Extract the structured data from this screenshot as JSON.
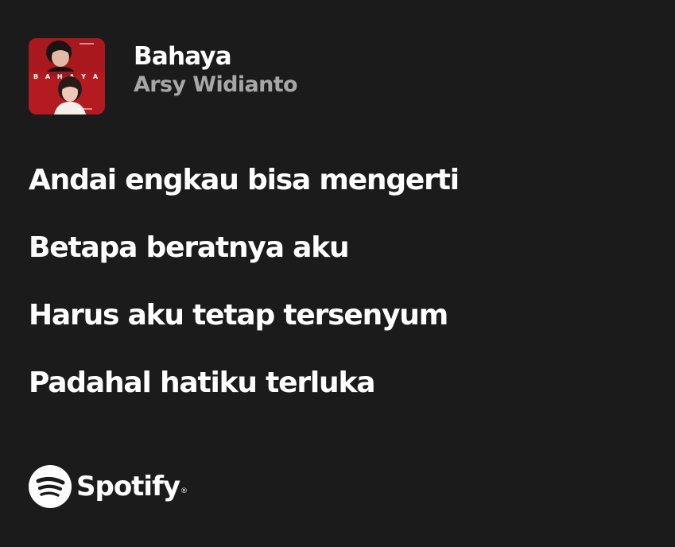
{
  "track": {
    "title": "Bahaya",
    "artist": "Arsy Widianto",
    "cover": {
      "lettering": "B A H A Y A",
      "background_color": "#b31b20"
    }
  },
  "lyrics": [
    "Andai engkau bisa mengerti",
    "Betapa beratnya aku",
    "Harus aku tetap tersenyum",
    "Padahal hatiku terluka"
  ],
  "brand": {
    "name": "Spotify",
    "icon": "spotify-logo-icon",
    "registered_mark": "®"
  },
  "colors": {
    "background": "#1b1b1b",
    "primary_text": "#ffffff",
    "secondary_text": "#a7a7a7"
  }
}
